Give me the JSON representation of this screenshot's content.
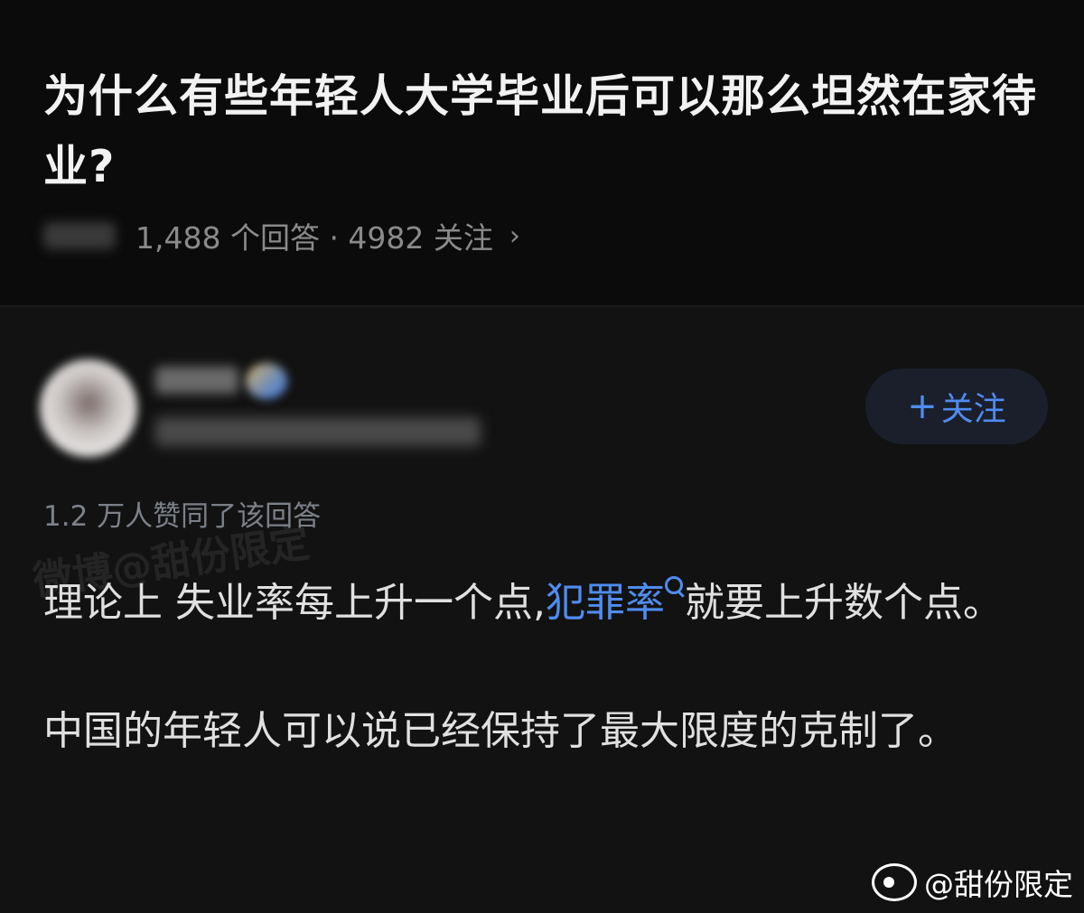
{
  "question": {
    "title": "为什么有些年轻人大学毕业后可以那么坦然在家待业?",
    "meta": "1,488 个回答 · 4982 关注",
    "chevron": "›"
  },
  "answer": {
    "follow_label": "关注",
    "follow_plus": "+",
    "upvotes": "1.2 万人赞同了该回答",
    "paragraph1_prefix": "理论上 失业率每上升一个点,",
    "paragraph1_link": "犯罪率",
    "paragraph1_suffix": "就要上升数个点。",
    "paragraph2": "中国的年轻人可以说已经保持了最大限度的克制了。"
  },
  "watermarks": {
    "diagonal": "微博@甜份限定",
    "corner": "@甜份限定"
  },
  "colors": {
    "background": "#000000",
    "answer_bg": "#121212",
    "accent": "#4f8cf0",
    "muted": "#7c8189"
  },
  "icons": {
    "chevron": "chevron-right-icon",
    "verified": "verified-badge-icon",
    "search": "search-icon",
    "weibo": "weibo-logo-icon"
  }
}
